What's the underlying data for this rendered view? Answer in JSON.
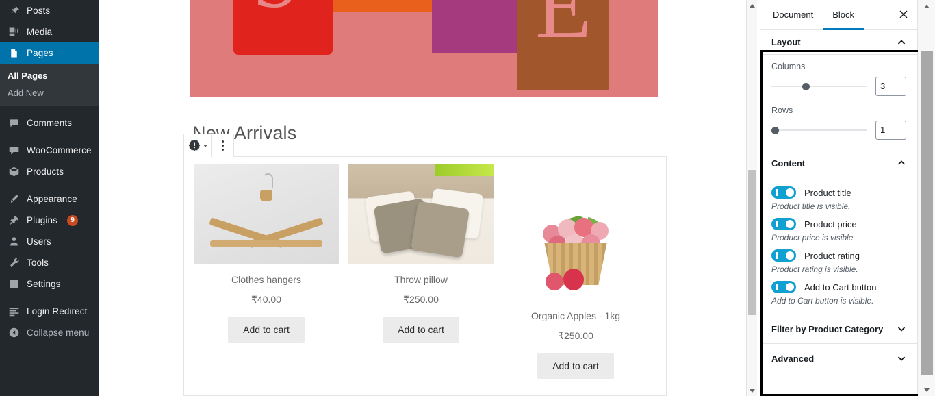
{
  "sidebar": {
    "items": [
      {
        "label": "Posts",
        "icon": "pin-icon",
        "current": false
      },
      {
        "label": "Media",
        "icon": "media-icon",
        "current": false
      },
      {
        "label": "Pages",
        "icon": "pages-icon",
        "current": true
      },
      {
        "label": "Comments",
        "icon": "comments-icon",
        "current": false
      },
      {
        "label": "WooCommerce",
        "icon": "woocommerce-icon",
        "current": false
      },
      {
        "label": "Products",
        "icon": "products-icon",
        "current": false
      },
      {
        "label": "Appearance",
        "icon": "appearance-icon",
        "current": false
      },
      {
        "label": "Plugins",
        "icon": "plugins-icon",
        "current": false,
        "badge": "9"
      },
      {
        "label": "Users",
        "icon": "users-icon",
        "current": false
      },
      {
        "label": "Tools",
        "icon": "tools-icon",
        "current": false
      },
      {
        "label": "Settings",
        "icon": "settings-icon",
        "current": false
      },
      {
        "label": "Login Redirect",
        "icon": "login-redirect-icon",
        "current": false
      },
      {
        "label": "Collapse menu",
        "icon": "collapse-icon",
        "current": false
      }
    ],
    "submenu": [
      {
        "label": "All Pages",
        "current": true
      },
      {
        "label": "Add New",
        "current": false
      }
    ]
  },
  "editor": {
    "heading": "New Arrivals",
    "toolbar": {
      "block_type_icon": "warning-badge-icon",
      "more_options_icon": "vertical-dots-icon"
    },
    "products": [
      {
        "title": "Clothes hangers",
        "price": "₹40.00",
        "cart_label": "Add to cart",
        "image": "clothes-hanger-photo"
      },
      {
        "title": "Throw pillow",
        "price": "₹250.00",
        "cart_label": "Add to cart",
        "image": "throw-pillow-photo"
      },
      {
        "title": "Organic Apples - 1kg",
        "price": "₹250.00",
        "cart_label": "Add to cart",
        "image": "organic-apples-photo"
      }
    ]
  },
  "panel": {
    "tabs": [
      {
        "label": "Document",
        "active": false
      },
      {
        "label": "Block",
        "active": true
      }
    ],
    "close_icon": "close-icon",
    "layout": {
      "title": "Layout",
      "columns_label": "Columns",
      "columns_value": "3",
      "rows_label": "Rows",
      "rows_value": "1"
    },
    "content": {
      "title": "Content",
      "toggles": [
        {
          "label": "Product title",
          "help": "Product title is visible.",
          "on": true
        },
        {
          "label": "Product price",
          "help": "Product price is visible.",
          "on": true
        },
        {
          "label": "Product rating",
          "help": "Product rating is visible.",
          "on": true
        },
        {
          "label": "Add to Cart button",
          "help": "Add to Cart button is visible.",
          "on": true
        }
      ]
    },
    "sections": [
      {
        "title": "Filter by Product Category"
      },
      {
        "title": "Advanced"
      }
    ],
    "colors": {
      "accent": "#007cba",
      "toggle_on": "#11a0d2",
      "highlight_border": "#000000",
      "sidebar_current": "#0073aa"
    }
  }
}
